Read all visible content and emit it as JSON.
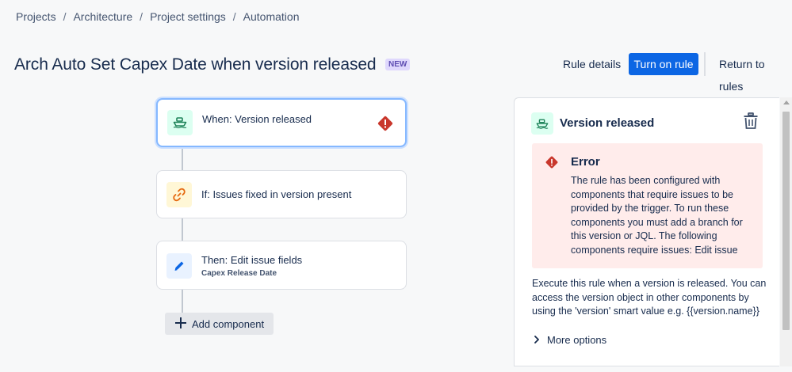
{
  "breadcrumb": [
    "Projects",
    "Architecture",
    "Project settings",
    "Automation"
  ],
  "breadcrumb_separator": "/",
  "page": {
    "title": "Arch Auto Set Capex Date when version released",
    "badge": "NEW"
  },
  "header_actions": {
    "rule_details": "Rule details",
    "turn_on_rule": "Turn on rule",
    "return_to_rules": "Return to rules"
  },
  "flow": {
    "trigger": {
      "label": "When: Version released",
      "icon": "ship-icon",
      "error_icon": "error-icon"
    },
    "condition": {
      "label": "If: Issues fixed in version present",
      "icon": "link-icon"
    },
    "action": {
      "label": "Then: Edit issue fields",
      "detail": "Capex Release Date",
      "icon": "pencil-icon"
    },
    "add_component": "Add component"
  },
  "panel": {
    "title": "Version released",
    "error": {
      "title": "Error",
      "message": "The rule has been configured with components that require issues to be provided by the trigger. To run these components you must add a branch for this version or JQL. The following components require issues: Edit issue"
    },
    "description": "Execute this rule when a version is released. You can access the version object in other components by using the 'version' smart value e.g. {{version.name}}",
    "more_options": "More options"
  },
  "colors": {
    "primary": "#0c66e4",
    "error": "#c9372c",
    "error_bg": "#ffeceb",
    "trigger_green": "#1f845a",
    "condition_orange": "#e56910",
    "action_blue": "#0c66e4"
  }
}
